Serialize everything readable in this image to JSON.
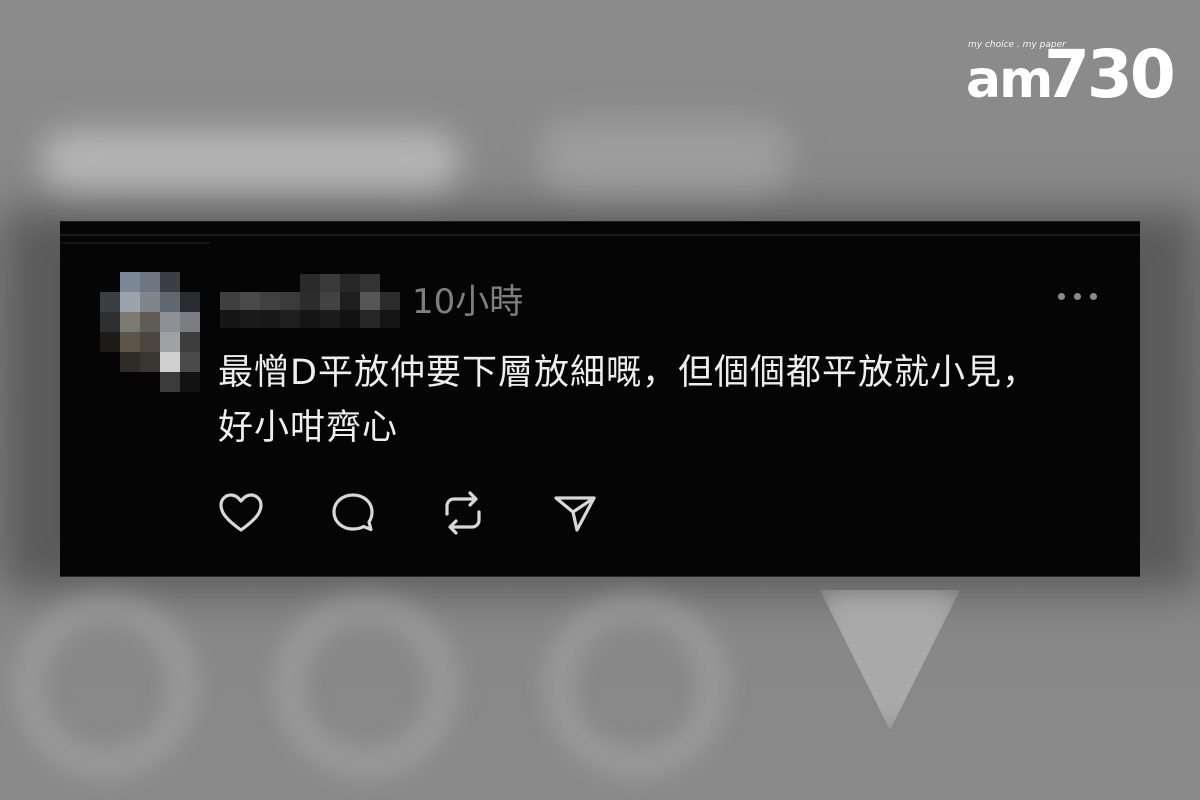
{
  "logo": {
    "tagline": "my choice . my paper",
    "am": "am",
    "number": "730"
  },
  "post": {
    "timestamp": "10小時",
    "text_lines": [
      "最憎D平放仲要下層放細嘅，但個個都平放就小見，",
      "好小咁齊心"
    ]
  },
  "actions": {
    "icons": [
      "heart-icon",
      "comment-icon",
      "repost-icon",
      "share-icon"
    ]
  },
  "colors": {
    "background": "#8a8a8a",
    "card": "#050505",
    "text": "#eeeeee",
    "muted": "#7e7e7e"
  }
}
